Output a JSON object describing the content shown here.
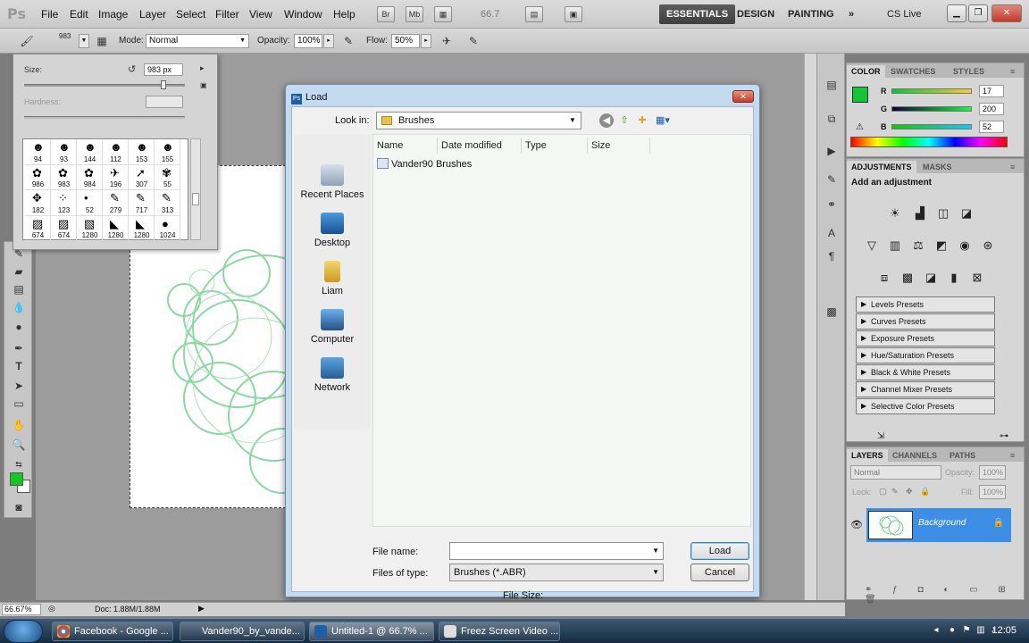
{
  "app": {
    "logo": "Ps"
  },
  "menu": [
    "File",
    "Edit",
    "Image",
    "Layer",
    "Select",
    "Filter",
    "View",
    "Window",
    "Help"
  ],
  "appbar": {
    "icon_br": "Br",
    "icon_mb": "Mb",
    "zoom": "66.7",
    "workspaces": [
      "ESSENTIALS",
      "DESIGN",
      "PAINTING"
    ],
    "more": "»",
    "cs_live": "CS Live"
  },
  "options": {
    "brush_size": "983",
    "mode_label": "Mode:",
    "mode_value": "Normal",
    "opacity_label": "Opacity:",
    "opacity_value": "100%",
    "flow_label": "Flow:",
    "flow_value": "50%"
  },
  "brush_picker": {
    "size_label": "Size:",
    "size_value": "983 px",
    "size_level_pct": 88,
    "hardness_label": "Hardness:",
    "brushes": [
      {
        "glyph": "☻",
        "num": "94"
      },
      {
        "glyph": "☻",
        "num": "93"
      },
      {
        "glyph": "☻",
        "num": "144"
      },
      {
        "glyph": "☻",
        "num": "112"
      },
      {
        "glyph": "☻",
        "num": "153"
      },
      {
        "glyph": "☻",
        "num": "155"
      },
      {
        "glyph": "✿",
        "num": "986"
      },
      {
        "glyph": "✿",
        "num": "983"
      },
      {
        "glyph": "✿",
        "num": "984"
      },
      {
        "glyph": "✈",
        "num": "196"
      },
      {
        "glyph": "➚",
        "num": "307"
      },
      {
        "glyph": "✾",
        "num": "55"
      },
      {
        "glyph": "✥",
        "num": "182"
      },
      {
        "glyph": "⁘",
        "num": "123"
      },
      {
        "glyph": "•",
        "num": "52"
      },
      {
        "glyph": "✎",
        "num": "279"
      },
      {
        "glyph": "✎",
        "num": "717"
      },
      {
        "glyph": "✎",
        "num": "313"
      },
      {
        "glyph": "▨",
        "num": "674"
      },
      {
        "glyph": "▨",
        "num": "674"
      },
      {
        "glyph": "▧",
        "num": "1280"
      },
      {
        "glyph": "◣",
        "num": "1280"
      },
      {
        "glyph": "◣",
        "num": "1280"
      },
      {
        "glyph": "●",
        "num": "1024"
      }
    ]
  },
  "dialog": {
    "title": "Load",
    "lookin_label": "Look in:",
    "lookin_value": "Brushes",
    "places": [
      "Recent Places",
      "Desktop",
      "Liam",
      "Computer",
      "Network"
    ],
    "columns": [
      "Name",
      "Date modified",
      "Type",
      "Size"
    ],
    "files": [
      "Vander90 Brushes"
    ],
    "filename_label": "File name:",
    "filename_value": "",
    "filetype_label": "Files of type:",
    "filetype_value": "Brushes (*.ABR)",
    "load_btn": "Load",
    "cancel_btn": "Cancel",
    "filesize_label": "File Size:"
  },
  "color_panel": {
    "tabs": [
      "COLOR",
      "SWATCHES",
      "STYLES"
    ],
    "r_label": "R",
    "g_label": "G",
    "b_label": "B",
    "r": "17",
    "g": "200",
    "b": "52",
    "fg_color": "#11c834"
  },
  "adjustments": {
    "tabs": [
      "ADJUSTMENTS",
      "MASKS"
    ],
    "title": "Add an adjustment",
    "presets": [
      "Levels Presets",
      "Curves Presets",
      "Exposure Presets",
      "Hue/Saturation Presets",
      "Black & White Presets",
      "Channel Mixer Presets",
      "Selective Color Presets"
    ]
  },
  "layers": {
    "tabs": [
      "LAYERS",
      "CHANNELS",
      "PATHS"
    ],
    "blend": "Normal",
    "opacity_label": "Opacity:",
    "opacity": "100%",
    "lock_label": "Lock:",
    "fill_label": "Fill:",
    "fill": "100%",
    "layer_name": "Background"
  },
  "status": {
    "zoom": "66.67%",
    "doc": "Doc: 1.88M/1.88M"
  },
  "taskbar": {
    "tasks": [
      "Facebook - Google ...",
      "Vander90_by_vande...",
      "Untitled-1 @ 66.7% ...",
      "Freez Screen Video ..."
    ],
    "clock": "12:05"
  }
}
